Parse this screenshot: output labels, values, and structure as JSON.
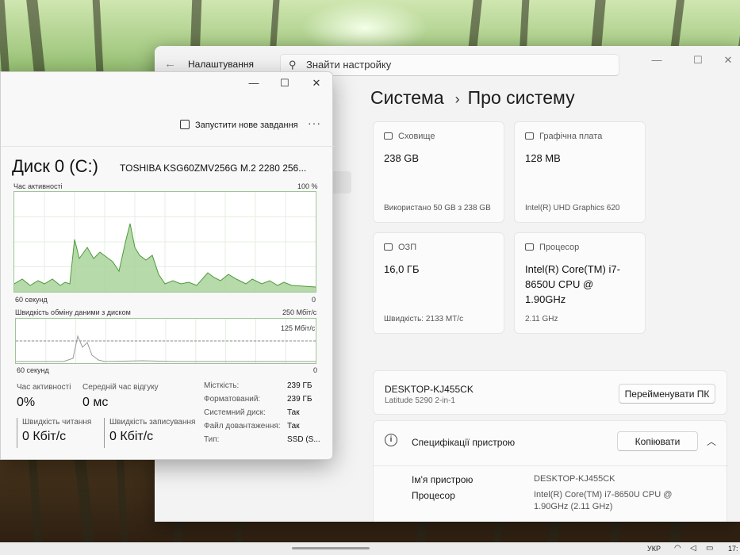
{
  "settings": {
    "app_title": "Налаштування",
    "search_placeholder": "Знайти настройку",
    "breadcrumb": {
      "parent": "Система",
      "current": "Про систему"
    },
    "cards": [
      {
        "id": "storage",
        "header": "Сховище",
        "value": "238 GB",
        "sub": "Використано 50 GB з 238 GB",
        "icon": "storage-icon"
      },
      {
        "id": "gpu",
        "header": "Графічна плата",
        "value": "128 MB",
        "sub": "Intel(R) UHD Graphics 620",
        "icon": "gpu-icon"
      },
      {
        "id": "ram",
        "header": "ОЗП",
        "value": "16,0 ГБ",
        "sub": "Швидкість: 2133 MT/с",
        "icon": "ram-icon"
      },
      {
        "id": "cpu",
        "header": "Процесор",
        "value": "Intel(R) Core(TM) i7-8650U CPU @ 1.90GHz",
        "sub": "2.11 GHz",
        "icon": "cpu-icon"
      }
    ],
    "device": {
      "name": "DESKTOP-KJ455CK",
      "model": "Latitude 5290 2-in-1",
      "rename_label": "Перейменувати ПК"
    },
    "specs": {
      "title": "Специфікації пристрою",
      "copy_label": "Копіювати",
      "rows": [
        {
          "label": "Ім'я пристрою",
          "value": "DESKTOP-KJ455CK"
        },
        {
          "label": "Процесор",
          "value": "Intel(R) Core(TM) i7-8650U CPU @ 1.90GHz (2.11 GHz)"
        }
      ]
    }
  },
  "task_manager": {
    "new_task_label": "Запустити нове завдання",
    "disk_title": "Диск 0 (C:)",
    "disk_model": "TOSHIBA KSG60ZMV256G M.2 2280 256...",
    "activity_graph": {
      "label": "Час активності",
      "max": "100 %",
      "time": "60 секунд",
      "min": "0"
    },
    "transfer_graph": {
      "label": "Швидкість обміну даними з диском",
      "max": "250 Мбіт/с",
      "mid": "125 Мбіт/с",
      "time": "60 секунд",
      "min": "0"
    },
    "stats": {
      "active_label": "Час активності",
      "active_value": "0%",
      "response_label": "Середній час відгуку",
      "response_value": "0 мс",
      "read_label": "Швидкість читання",
      "read_value": "0 Кбіт/с",
      "write_label": "Швидкість записування",
      "write_value": "0 Кбіт/с"
    },
    "props": [
      {
        "label": "Місткість:",
        "value": "239 ГБ"
      },
      {
        "label": "Форматований:",
        "value": "239 ГБ"
      },
      {
        "label": "Системний диск:",
        "value": "Так"
      },
      {
        "label": "Файл довантаження:",
        "value": "Так"
      },
      {
        "label": "Тип:",
        "value": "SSD (S..."
      }
    ]
  },
  "taskbar": {
    "lang": "УКР",
    "clock": "17:"
  },
  "colors": {
    "graph_fill": "#a9d39a",
    "graph_line": "#4d9a3c",
    "graph_border": "#9ec594"
  }
}
